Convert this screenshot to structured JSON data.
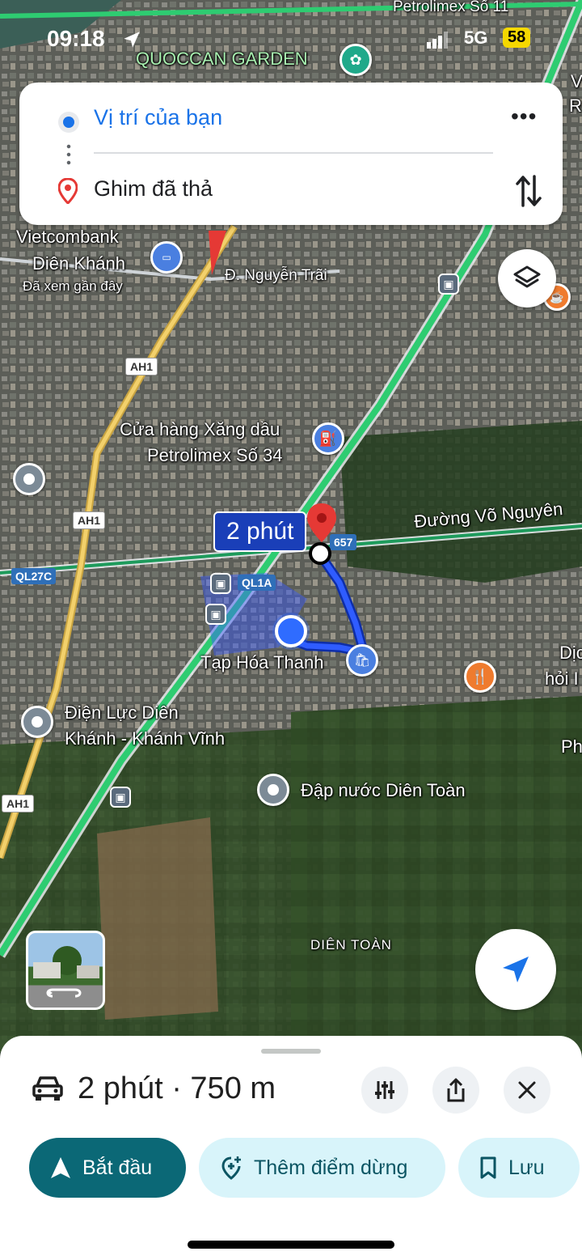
{
  "status_bar": {
    "time": "09:18",
    "network": "5G",
    "battery": "58"
  },
  "route_card": {
    "origin": "Vị trí của bạn",
    "destination": "Ghim đã thả",
    "more_icon": "more-horizontal-icon",
    "swap_icon": "swap-vertical-icon"
  },
  "map": {
    "places": {
      "quoccan": "QUOCCAN GARDEN",
      "petrolimex_11": "Petrolimex Số 11",
      "vietcombank_1": "Vietcombank",
      "vietcombank_2": "Diên Khánh",
      "vietcombank_sub": "Đã xem gần đây",
      "nguyen_trai": "Đ. Nguyễn Trãi",
      "xang_dau_1": "Cửa hàng Xăng dầu",
      "xang_dau_2": "Petrolimex Số 34",
      "vo_nguyen": "Đường Võ Nguyên",
      "tap_hoa": "Tạp Hóa Thanh",
      "dien_luc_1": "Điện Lực Diên",
      "dien_luc_2": "Khánh - Khánh Vĩnh",
      "dap_nuoc": "Đập nước Diên Toàn",
      "dien_toan": "DIÊN TOÀN",
      "edge_dic": "Dịc",
      "edge_hoi": "hỏi I",
      "edge_ph": "Ph",
      "edge_v": "V",
      "edge_r": "R"
    },
    "shields": {
      "ah1_top": "AH1",
      "ah1_mid": "AH1",
      "ah1_bottom": "AH1",
      "ql27c": "QL27C",
      "ql1a": "QL1A",
      "r657": "657"
    },
    "eta_bubble": "2 phút",
    "colors": {
      "route": "#1a4fd8",
      "traffic": "#2ecc71",
      "pin": "#e53935"
    }
  },
  "bottom_sheet": {
    "summary": "2 phút · 750 m",
    "car_icon": "car-icon",
    "buttons": {
      "start": "Bắt đầu",
      "add_stop": "Thêm điểm dừng",
      "save": "Lưu"
    }
  }
}
